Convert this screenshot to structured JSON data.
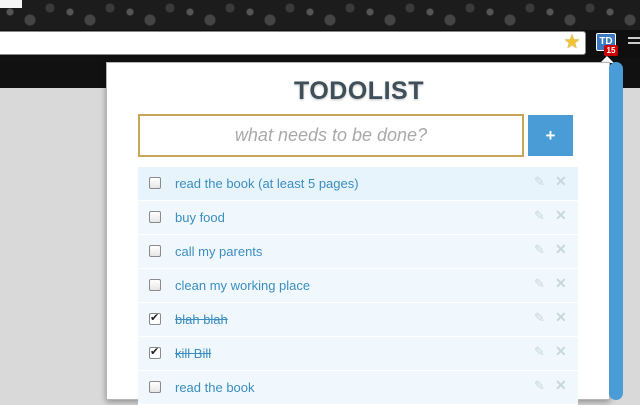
{
  "browser": {
    "extension_icon_label": "TD",
    "extension_badge": "15",
    "bookmark_icon": "star-icon",
    "menu_icon": "menu-icon"
  },
  "popup": {
    "title": "TODOLIST",
    "input": {
      "value": "",
      "placeholder": "what needs to be done?"
    },
    "add_label": "+",
    "items": [
      {
        "label": "read the book (at least 5 pages)",
        "done": false
      },
      {
        "label": "buy food",
        "done": false
      },
      {
        "label": "call my parents",
        "done": false
      },
      {
        "label": "clean my working place",
        "done": false
      },
      {
        "label": "blah blah",
        "done": true
      },
      {
        "label": "kill Bill",
        "done": true
      },
      {
        "label": "read the book",
        "done": false
      }
    ]
  },
  "colors": {
    "accent": "#4a9cd6",
    "item_text": "#3b8ec2",
    "input_border": "#c9a55a",
    "badge": "#cc0000"
  }
}
